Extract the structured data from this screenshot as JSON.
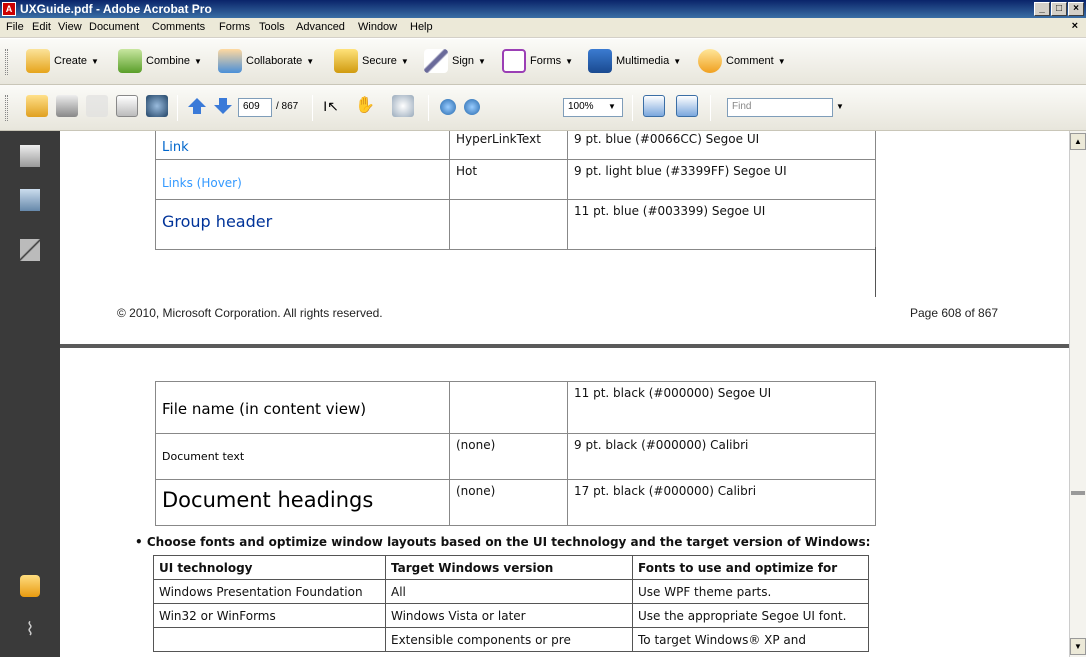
{
  "window": {
    "title": "UXGuide.pdf - Adobe Acrobat Pro"
  },
  "menu": [
    "File",
    "Edit",
    "View",
    "Document",
    "Comments",
    "Forms",
    "Tools",
    "Advanced",
    "Window",
    "Help"
  ],
  "tasks": {
    "create": "Create",
    "combine": "Combine",
    "collaborate": "Collaborate",
    "secure": "Secure",
    "sign": "Sign",
    "forms": "Forms",
    "multimedia": "Multimedia",
    "comment": "Comment"
  },
  "nav": {
    "page_value": "609",
    "page_total": "/ 867",
    "zoom": "100%",
    "find_placeholder": "Find"
  },
  "page1": {
    "rows": [
      {
        "name": "Link",
        "token": "HyperLinkText",
        "desc": "9 pt. blue (#0066CC) Segoe UI",
        "color": "#0066cc"
      },
      {
        "name": "Links (Hover)",
        "token": "Hot",
        "desc": "9 pt. light blue (#3399FF) Segoe UI",
        "color": "#3399ff"
      },
      {
        "name": "Group header",
        "token": "",
        "desc": "11 pt. blue (#003399) Segoe UI",
        "color": "#003399"
      }
    ],
    "copyright": "© 2010, Microsoft Corporation. All rights reserved.",
    "page_label": "Page 608 of 867"
  },
  "page2": {
    "rows": [
      {
        "name": "File name (in content view)",
        "token": "",
        "desc": "11 pt. black (#000000) Segoe UI"
      },
      {
        "name": "Document text",
        "token": "(none)",
        "desc": "9 pt. black (#000000) Calibri"
      },
      {
        "name": "Document headings",
        "token": "(none)",
        "desc": "17 pt. black (#000000) Calibri"
      }
    ],
    "bullet": "Choose fonts and optimize window layouts based on the UI technology and the target version of Windows:",
    "win_table": {
      "headers": [
        "UI technology",
        "Target Windows version",
        "Fonts to use and optimize for"
      ],
      "rows": [
        [
          "Windows Presentation Foundation",
          "All",
          "Use WPF theme parts."
        ],
        [
          "Win32 or WinForms",
          "Windows Vista or later",
          "Use the appropriate Segoe UI font."
        ],
        [
          "",
          "Extensible components or pre",
          "To target Windows® XP and"
        ]
      ]
    }
  }
}
